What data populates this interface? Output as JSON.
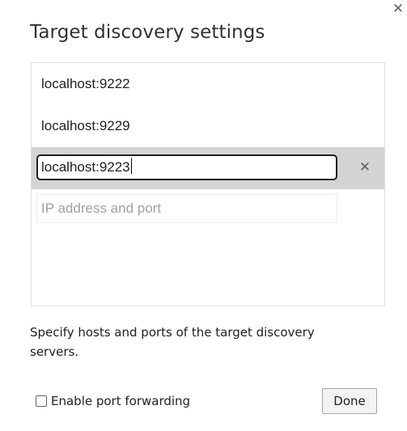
{
  "dialog": {
    "title": "Target discovery settings",
    "close_icon": "close-icon"
  },
  "targets": {
    "items": [
      {
        "value": "localhost:9222"
      },
      {
        "value": "localhost:9229"
      },
      {
        "value": "localhost:9223",
        "editing": true
      }
    ],
    "remove_icon": "close-icon",
    "new_placeholder": "IP address and port"
  },
  "help": {
    "text": "Specify hosts and ports of the target discovery servers."
  },
  "footer": {
    "port_forwarding_label": "Enable port forwarding",
    "port_forwarding_checked": false,
    "done_label": "Done"
  }
}
